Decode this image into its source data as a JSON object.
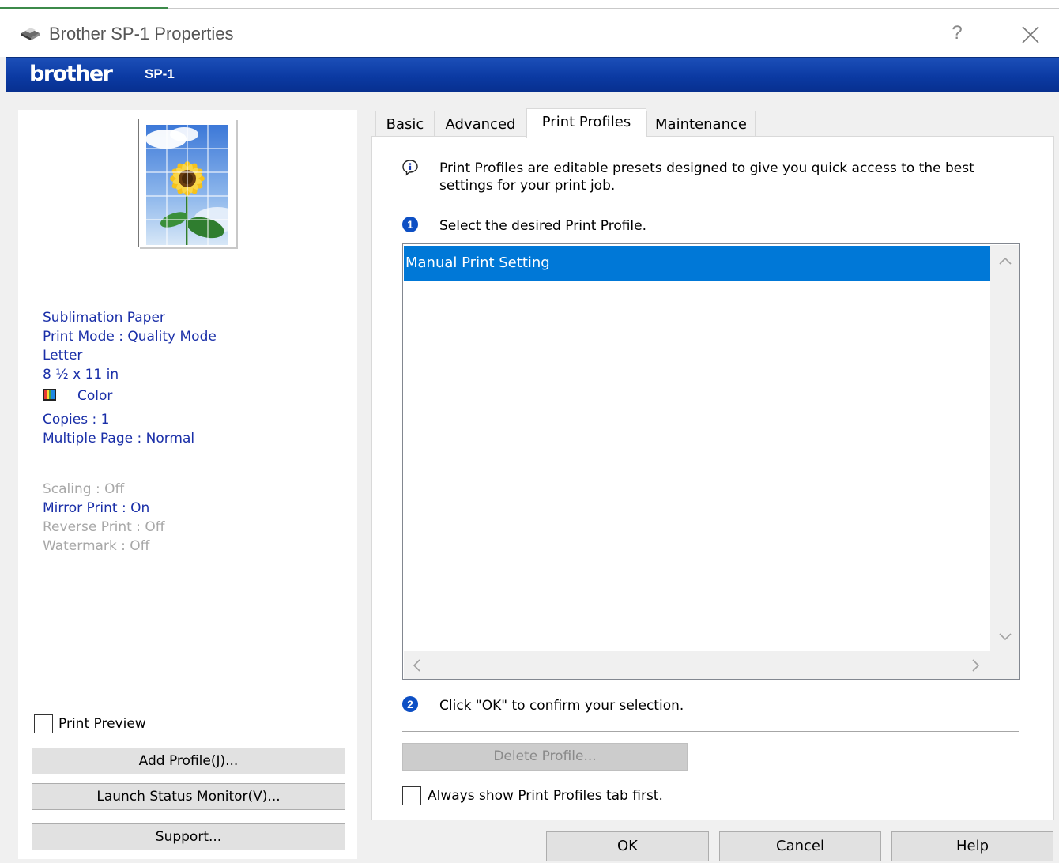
{
  "window": {
    "title": "Brother SP-1 Properties",
    "help_glyph": "?",
    "close_glyph": "✕"
  },
  "banner": {
    "brand": "brother",
    "model": "SP-1",
    "bg_color": "#0b3aa3"
  },
  "summary": {
    "media": "Sublimation Paper",
    "print_mode": "Print Mode : Quality Mode",
    "paper_size": "Letter",
    "paper_dims": "8 ½ x 11 in",
    "color_mode": "Color",
    "copies": "Copies : 1",
    "multiple_page": "Multiple Page : Normal",
    "scaling": "Scaling : Off",
    "mirror_print": "Mirror Print : On",
    "reverse_print": "Reverse Print : Off",
    "watermark": "Watermark : Off"
  },
  "left_controls": {
    "print_preview_label": "Print Preview",
    "print_preview_checked": false,
    "add_profile_label": "Add Profile(J)...",
    "launch_status_label": "Launch Status Monitor(V)...",
    "support_label": "Support..."
  },
  "tabs": [
    {
      "label": "Basic",
      "active": false
    },
    {
      "label": "Advanced",
      "active": false
    },
    {
      "label": "Print Profiles",
      "active": true
    },
    {
      "label": "Maintenance",
      "active": false
    }
  ],
  "print_profiles": {
    "intro": "Print Profiles are editable presets designed to give you quick access to the best settings for your print job.",
    "step1_label": "Select the desired Print Profile.",
    "profiles": [
      "Manual Print Setting"
    ],
    "selected_index": 0,
    "step2_label": "Click \"OK\" to confirm your selection.",
    "delete_label": "Delete Profile...",
    "always_show_label": "Always show Print Profiles tab first.",
    "always_show_checked": false,
    "selection_color": "#0078d7"
  },
  "footer": {
    "ok_label": "OK",
    "cancel_label": "Cancel",
    "help_label": "Help"
  }
}
